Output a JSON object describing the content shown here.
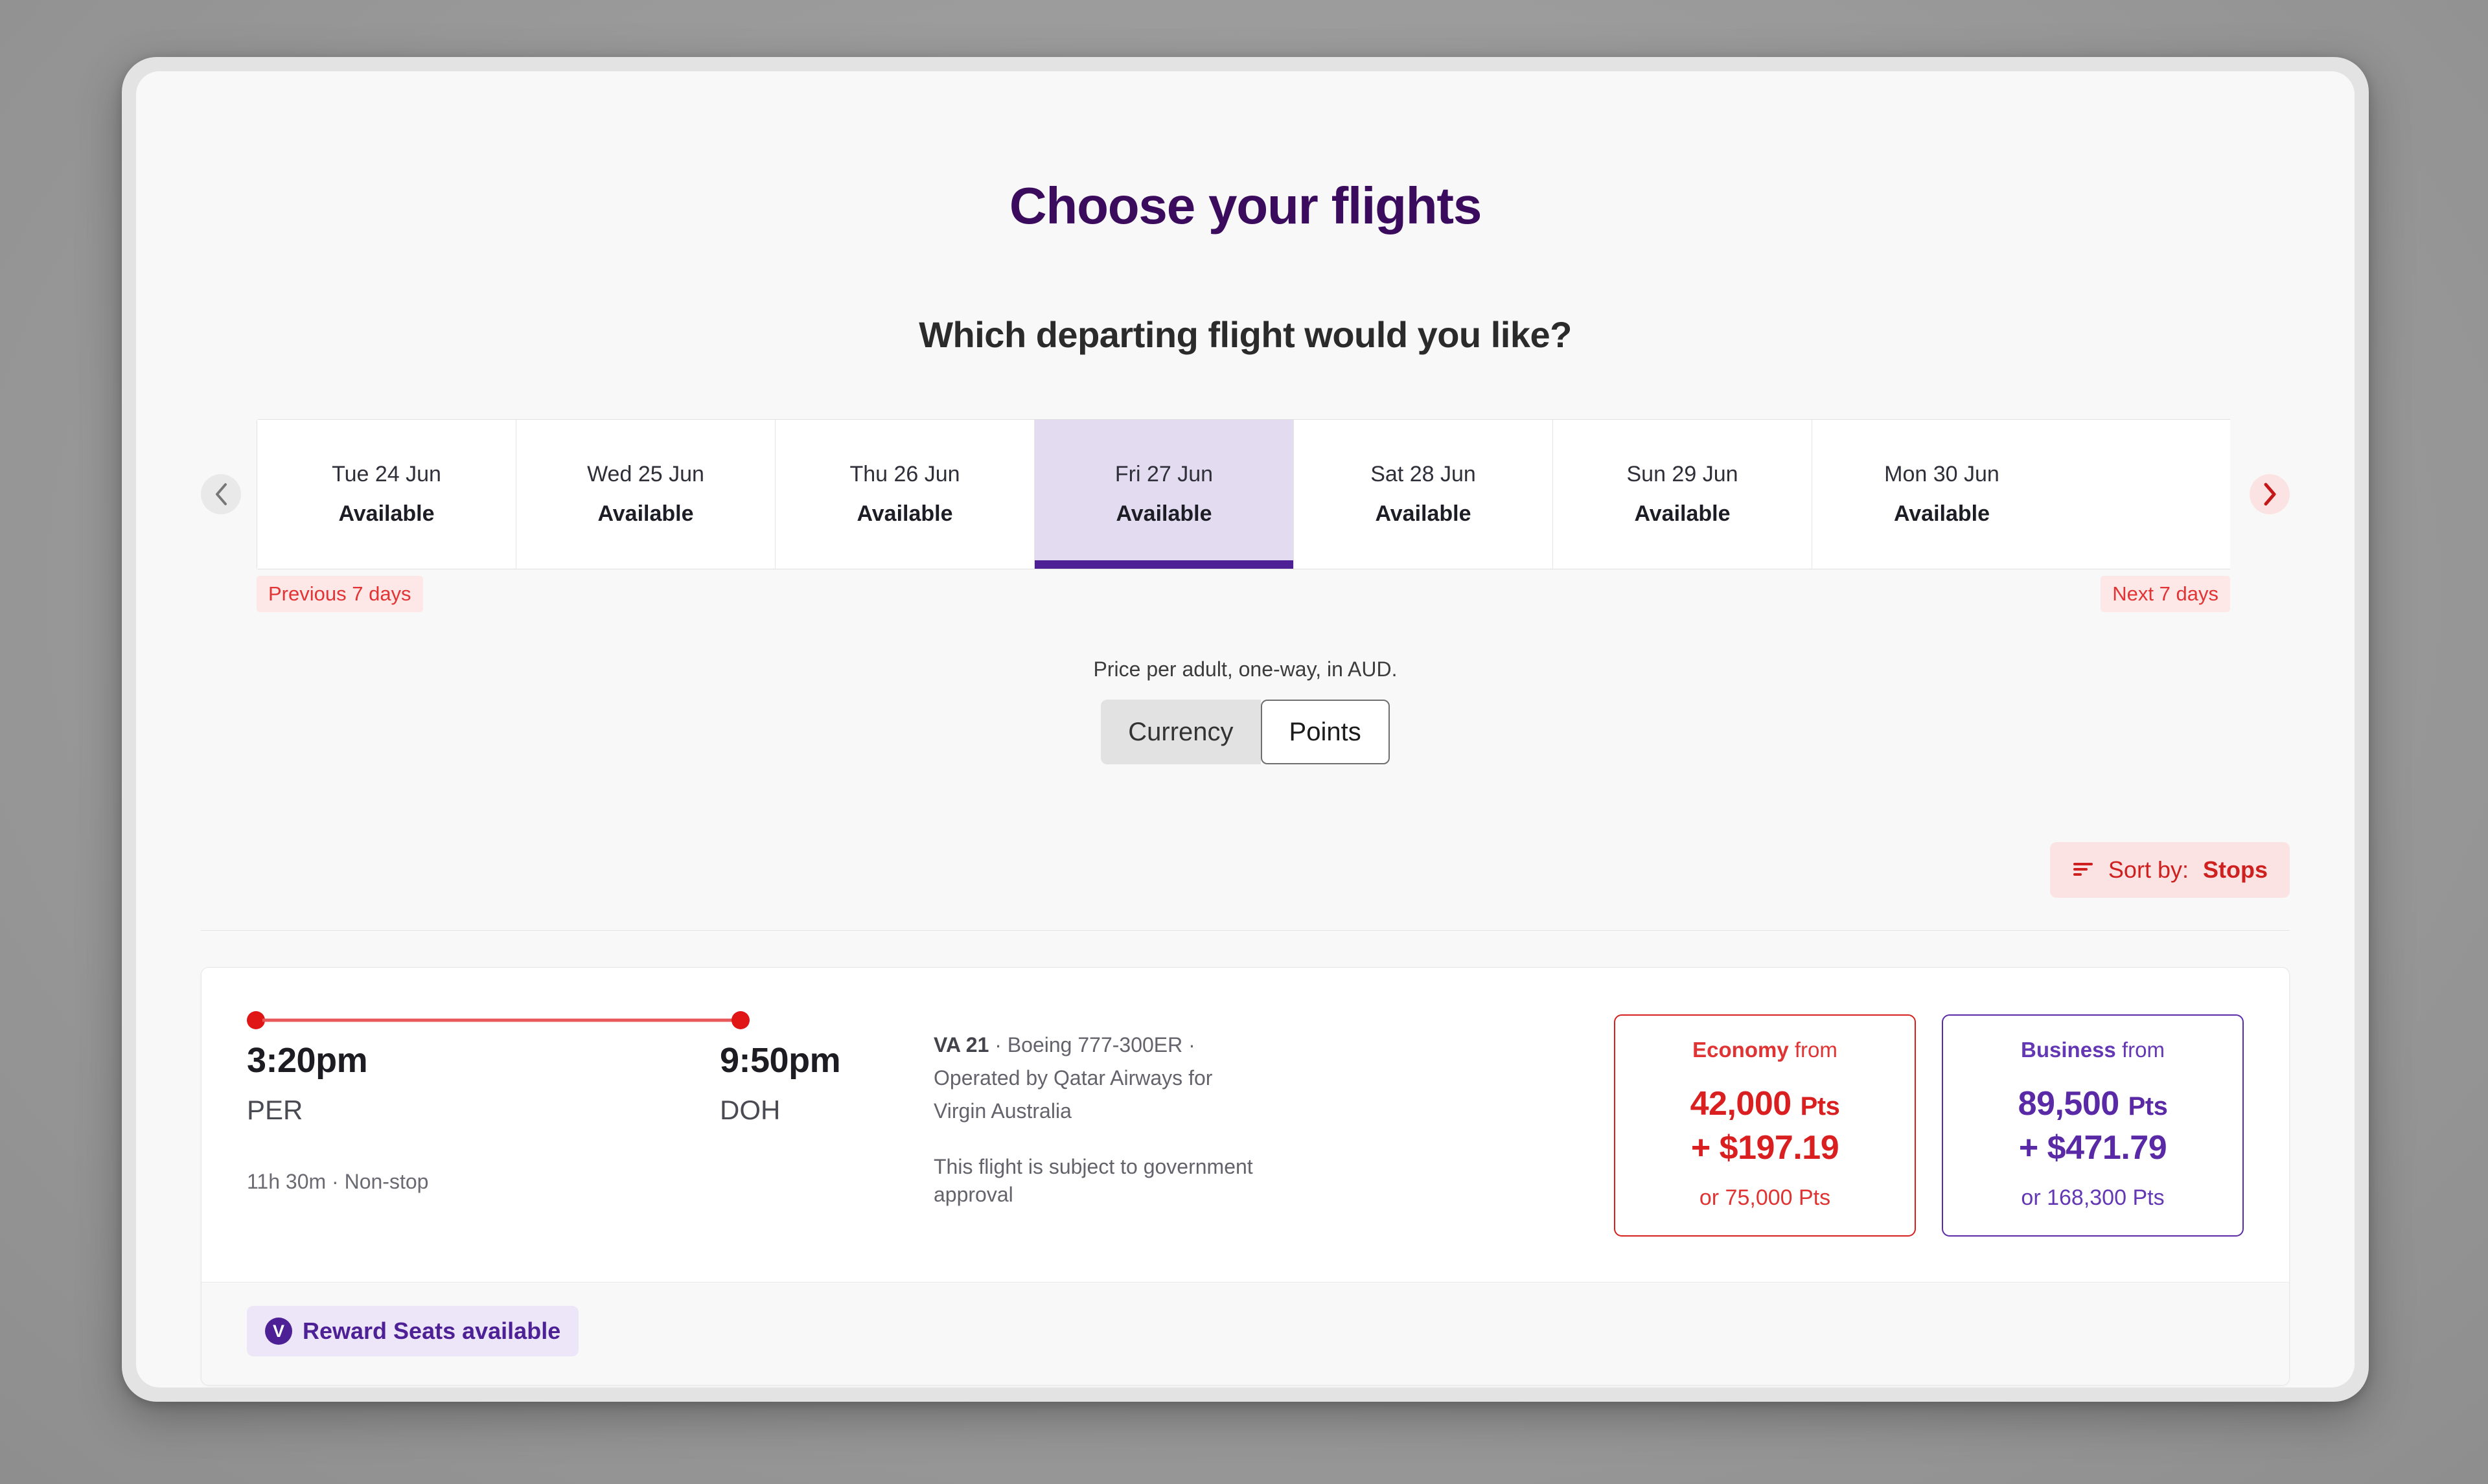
{
  "page": {
    "title": "Choose your flights",
    "subtitle": "Which departing flight would you like?"
  },
  "date_selector": {
    "prev_arrow_icon": "chevron-left-icon",
    "next_arrow_icon": "chevron-right-icon",
    "prev_chip": "Previous 7 days",
    "next_chip": "Next 7 days",
    "selected_index": 3,
    "days": [
      {
        "date": "Tue 24 Jun",
        "status": "Available"
      },
      {
        "date": "Wed 25 Jun",
        "status": "Available"
      },
      {
        "date": "Thu 26 Jun",
        "status": "Available"
      },
      {
        "date": "Fri 27 Jun",
        "status": "Available"
      },
      {
        "date": "Sat 28 Jun",
        "status": "Available"
      },
      {
        "date": "Sun 29 Jun",
        "status": "Available"
      },
      {
        "date": "Mon 30 Jun",
        "status": "Available"
      }
    ]
  },
  "price_basis": {
    "note": "Price per adult, one-way, in AUD.",
    "options": [
      "Currency",
      "Points"
    ],
    "selected": "Points"
  },
  "sort": {
    "icon": "sort-icon",
    "label": "Sort by:",
    "value": "Stops"
  },
  "flight": {
    "depart_time": "3:20pm",
    "depart_airport": "PER",
    "arrive_time": "9:50pm",
    "arrive_airport": "DOH",
    "duration_stops": "11h 30m · Non-stop",
    "flight_number": "VA 21",
    "aircraft_line": " · Boeing 777-300ER ·",
    "operated_by": "Operated by Qatar Airways for",
    "marketing_carrier": "Virgin Australia",
    "government_notice": "This flight is subject to government approval",
    "fares": [
      {
        "cabin": "Economy",
        "from_label": "from",
        "points": "42,000",
        "points_unit": "Pts",
        "cash": "+ $197.19",
        "alternative": "or 75,000 Pts",
        "color": "#d91f1f"
      },
      {
        "cabin": "Business",
        "from_label": "from",
        "points": "89,500",
        "points_unit": "Pts",
        "cash": "+ $471.79",
        "alternative": "or 168,300 Pts",
        "color": "#5a2aa6"
      }
    ],
    "reward_badge": {
      "icon_letter": "V",
      "text": "Reward Seats available"
    }
  }
}
